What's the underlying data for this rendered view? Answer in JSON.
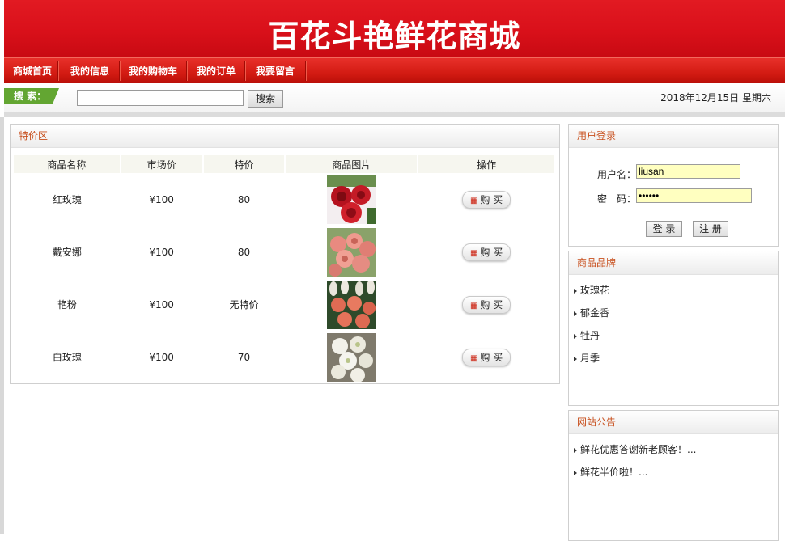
{
  "site": {
    "title": "百花斗艳鲜花商城"
  },
  "nav": [
    "商城首页",
    "我的信息",
    "我的购物车",
    "我的订单",
    "我要留言"
  ],
  "search": {
    "label": "搜 索：",
    "value": "",
    "button": "搜索"
  },
  "date": "2018年12月15日 星期六",
  "special": {
    "title": "特价区",
    "headers": [
      "商品名称",
      "市场价",
      "特价",
      "商品图片",
      "操作"
    ],
    "buy_label": "购 买",
    "rows": [
      {
        "name": "红玫瑰",
        "market": "¥100",
        "special": "80",
        "image": "red-rose-photo"
      },
      {
        "name": "戴安娜",
        "market": "¥100",
        "special": "80",
        "image": "pink-rose-photo"
      },
      {
        "name": "艳粉",
        "market": "¥100",
        "special": "无特价",
        "image": "salmon-rose-photo"
      },
      {
        "name": "白玫瑰",
        "market": "¥100",
        "special": "70",
        "image": "white-rose-photo"
      }
    ]
  },
  "login": {
    "title": "用户登录",
    "username_label": "用户名：",
    "username_value": "liusan",
    "password_label": "密　码：",
    "password_value": "••••••",
    "login_button": "登 录",
    "register_button": "注 册"
  },
  "brands": {
    "title": "商品品牌",
    "items": [
      "玫瑰花",
      "郁金香",
      "牡丹",
      "月季"
    ]
  },
  "notice": {
    "title": "网站公告",
    "items": [
      "鲜花优惠答谢新老顾客！...",
      "鲜花半价啦！..."
    ]
  },
  "colors": {
    "header_red": "#d9101a",
    "nav_red": "#d21a12",
    "search_green": "#63a632",
    "panel_title": "#c8501e",
    "input_yellow": "#ffffc0"
  }
}
